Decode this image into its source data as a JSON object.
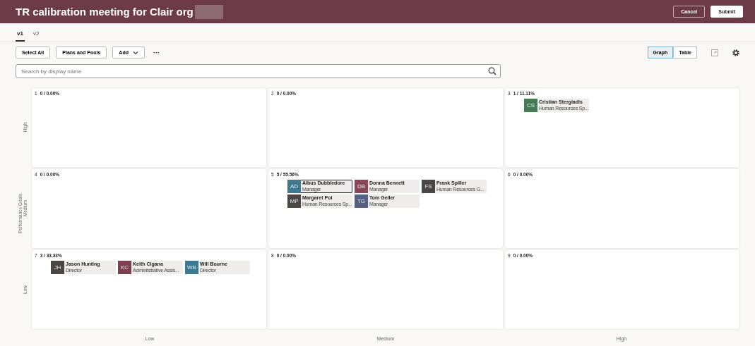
{
  "header": {
    "title": "TR calibration meeting for Clair org",
    "buttons": [
      {
        "label": "Cancel",
        "kind": "secondary"
      },
      {
        "label": "Submit",
        "kind": "primary"
      }
    ]
  },
  "tabs": [
    {
      "label": "v1",
      "selected": true
    },
    {
      "label": "v2",
      "selected": false
    }
  ],
  "toolbar": {
    "buttons": [
      {
        "label": "Select All",
        "kind": "plain"
      },
      {
        "label": "Plans and Pools",
        "kind": "plain"
      },
      {
        "label": "Add",
        "kind": "menu"
      }
    ],
    "more": "···",
    "view_toggle": [
      {
        "label": "Graph",
        "selected": true
      },
      {
        "label": "Table",
        "selected": false
      }
    ]
  },
  "search": {
    "placeholder": "Search by display name"
  },
  "y_axis": {
    "title": "Performance Goals",
    "labels": [
      "High",
      "Medium",
      "Low"
    ]
  },
  "x_axis": {
    "labels": [
      "Low",
      "Medium",
      "High"
    ]
  },
  "boxes": [
    {
      "number": "1",
      "summary": "0 / 0.00%"
    },
    {
      "number": "2",
      "summary": "0 / 0.00%"
    },
    {
      "number": "3",
      "summary": "1 / 11.11%",
      "people": [
        {
          "initials": "CS",
          "name": "Cristian Stergiadis",
          "role": "Human Resources Sp...",
          "color": "#467a55",
          "selected": false
        }
      ]
    },
    {
      "number": "4",
      "summary": "0 / 0.00%"
    },
    {
      "number": "5",
      "summary": "5 / 55.56%",
      "people": [
        {
          "initials": "AD",
          "name": "Albus Dubbledore",
          "role": "Manager",
          "color": "#3d7a90",
          "selected": true
        },
        {
          "initials": "DB",
          "name": "Donna Bennett",
          "role": "Manager",
          "color": "#8a4558",
          "selected": false
        },
        {
          "initials": "FS",
          "name": "Frank Spiller",
          "role": "Human Resources G...",
          "color": "#4a4744",
          "selected": false
        },
        {
          "initials": "MP",
          "name": "Margaret Poi",
          "role": "Human Resources Sp...",
          "color": "#4a4744",
          "selected": false
        },
        {
          "initials": "TG",
          "name": "Tom Geller",
          "role": "Manager",
          "color": "#566182",
          "selected": false
        }
      ]
    },
    {
      "number": "6",
      "summary": "0 / 0.00%"
    },
    {
      "number": "7",
      "summary": "3 / 33.33%",
      "people": [
        {
          "initials": "JH",
          "name": "Jason Hunting",
          "role": "Director",
          "color": "#4a4744",
          "selected": false
        },
        {
          "initials": "KC",
          "name": "Keith Cigana",
          "role": "Adminitstrative Assis...",
          "color": "#7c4050",
          "selected": false
        },
        {
          "initials": "WB",
          "name": "Will Bourne",
          "role": "Director",
          "color": "#3d7a90",
          "selected": false
        }
      ]
    },
    {
      "number": "8",
      "summary": "0 / 0.00%"
    },
    {
      "number": "9",
      "summary": "0 / 0.00%"
    }
  ]
}
